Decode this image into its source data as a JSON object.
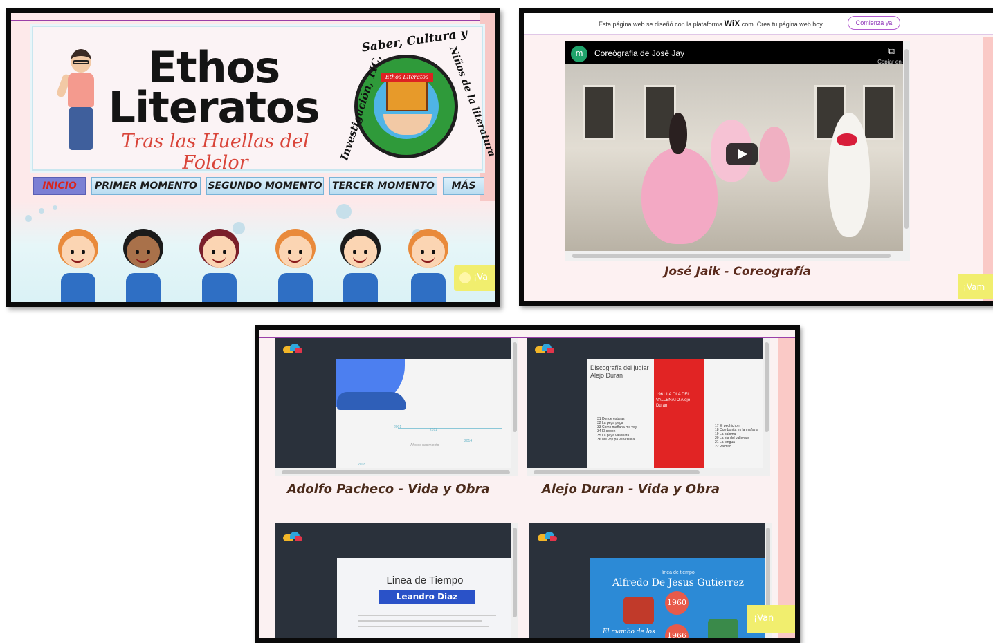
{
  "panel1": {
    "title_line1": "Ethos",
    "title_line2": "Literatos",
    "subtitle": "Tras las Huellas del Folclor",
    "emblem_arc_left": "Investigación, TIC,",
    "emblem_arc_top": "Saber, Cultura y",
    "emblem_arc_right": "Niños de la literatura",
    "emblem_school_label": "Ethos Literatos",
    "nav": [
      "INICIO",
      "PRIMER MOMENTO",
      "SEGUNDO MOMENTO",
      "TERCER MOMENTO",
      "MÁS"
    ],
    "chat_label": "¡Va"
  },
  "panel2": {
    "wix_text_before": "Esta página web se diseñó con la plataforma",
    "wix_brand": "WiX",
    "wix_text_after": ".com. Crea tu página web hoy.",
    "wix_button": "Comienza ya",
    "video_logo": "m",
    "video_title": "Coreógrafia de José Jay",
    "copy_label": "Copiar enla",
    "caption": "José Jaik - Coreografía",
    "chat_label": "¡Vam"
  },
  "panel3": {
    "caption_left": "Adolfo Pacheco - Vida y Obra",
    "caption_right": "Alejo Duran - Vida y Obra",
    "slide2_heading": "Discografía del juglar Alejo Duran",
    "slide2_red_text": "1961 LA OLA DEL VALLENATO Alejo Duran",
    "slide2_list_left": [
      "31 Donde estaras",
      "32 La pega pega",
      "33 Como mañana me voy",
      "34 El sobon",
      "35 La puya vallenata",
      "36 Me voy pa venezuela"
    ],
    "slide2_list_right": [
      "17 El pechichon",
      "18 Que bonita es la mañana",
      "19 La paloma",
      "20 La ola del vallenato",
      "21 La lengua",
      "22 Palmito"
    ],
    "slide1_years": [
      "2001",
      "2011",
      "2014",
      "2018"
    ],
    "slide1_mid_label": "Año de nacimiento",
    "slide3_title": "Linea de Tiempo",
    "slide3_name": "Leandro Diaz",
    "slide4_small": "linea de tiempo",
    "slide4_title": "Alfredo De Jesus Gutierrez",
    "slide4_years": [
      "1960",
      "1966"
    ],
    "slide4_album": "El mambo de los",
    "chat_label": "¡Van"
  },
  "colors": {
    "nav_active_bg": "#7b7fd4",
    "nav_active_text": "#d9251d",
    "wix_button": "#8e34b8",
    "caption": "#4a2a1a",
    "accent_purple_line": "#9a3fa8"
  }
}
